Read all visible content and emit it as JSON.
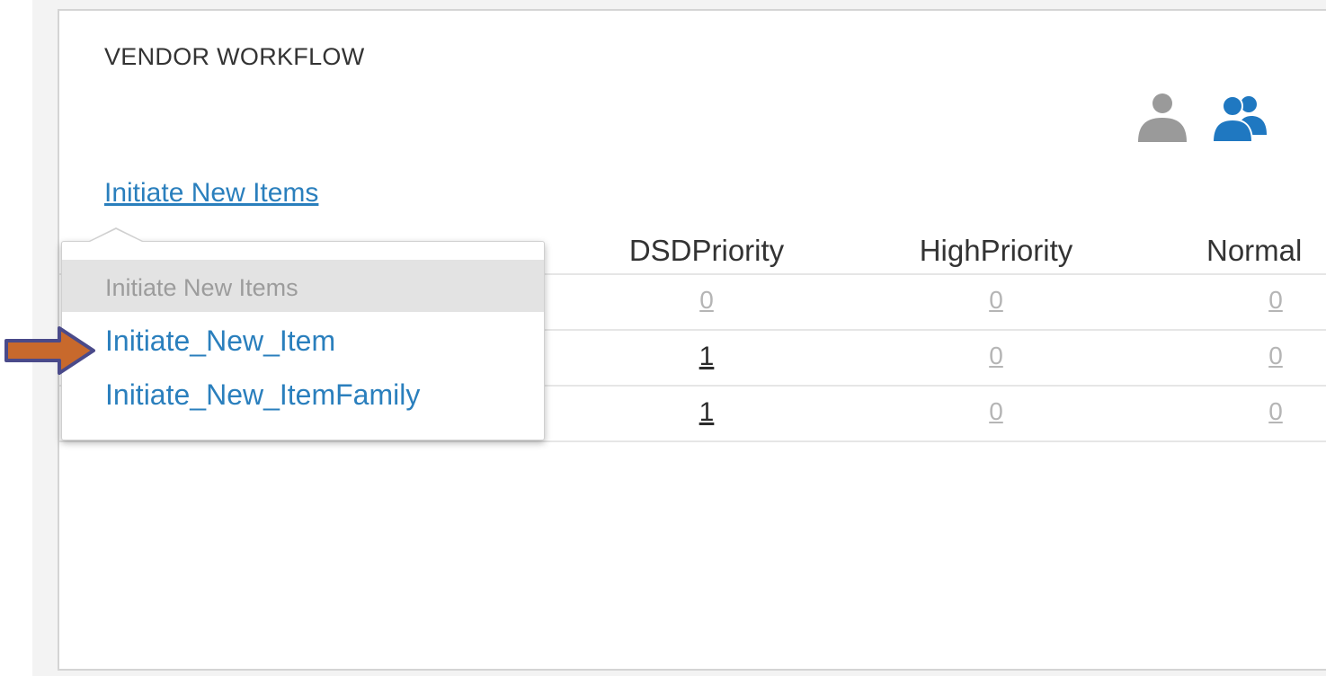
{
  "panel": {
    "title": "VENDOR WORKFLOW",
    "icons": [
      {
        "name": "single-user-icon",
        "color": "#9a9a9a"
      },
      {
        "name": "user-group-icon",
        "color": "#1f78c1"
      }
    ]
  },
  "initiate_link": "Initiate New Items",
  "dropdown": {
    "header": "Initiate New Items",
    "items": [
      "Initiate_New_Item",
      "Initiate_New_ItemFamily"
    ]
  },
  "table": {
    "columns": [
      "DSDPriority",
      "HighPriority",
      "Normal"
    ],
    "rows": [
      [
        "0",
        "0",
        "0"
      ],
      [
        "1",
        "0",
        "0"
      ],
      [
        "1",
        "0",
        "0"
      ]
    ]
  },
  "colors": {
    "link": "#2a7fbd",
    "arrow_fill": "#c8692c",
    "arrow_outline": "#4a4a8a"
  }
}
